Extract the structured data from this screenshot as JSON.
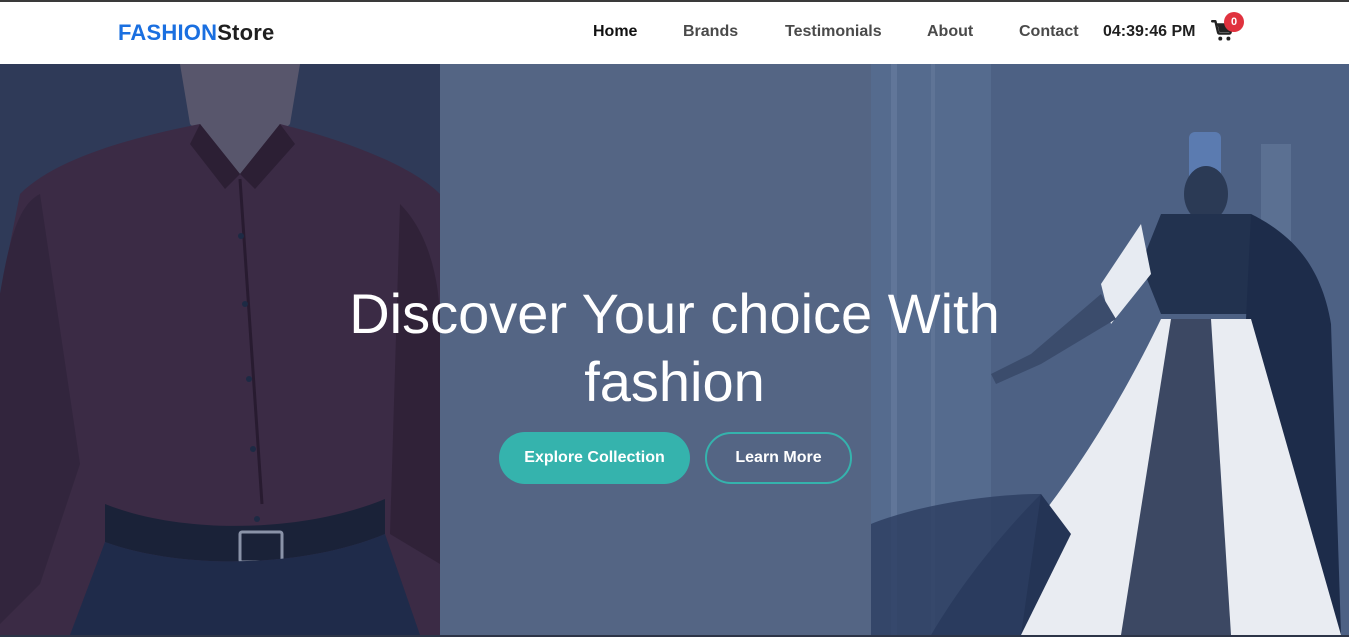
{
  "brand": {
    "part1": "FASHION",
    "part2": "Store"
  },
  "nav": {
    "items": [
      {
        "label": "Home",
        "active": true
      },
      {
        "label": "Brands",
        "active": false
      },
      {
        "label": "Testimonials",
        "active": false
      },
      {
        "label": "About",
        "active": false
      },
      {
        "label": "Contact",
        "active": false
      }
    ]
  },
  "clock": "04:39:46 PM",
  "cart": {
    "icon": "cart-icon",
    "count": "0"
  },
  "hero": {
    "title_line1": "Discover Your choice With",
    "title_line2": "fashion",
    "primary_button": "Explore Collection",
    "secondary_button": "Learn More",
    "left_image": "man-in-shirt-photo",
    "right_image": "woman-in-lehenga-photo"
  },
  "colors": {
    "brand_accent": "#1a6fe0",
    "button_teal": "#35b3ad",
    "hero_overlay": "#546584",
    "badge_red": "#e0323e"
  }
}
